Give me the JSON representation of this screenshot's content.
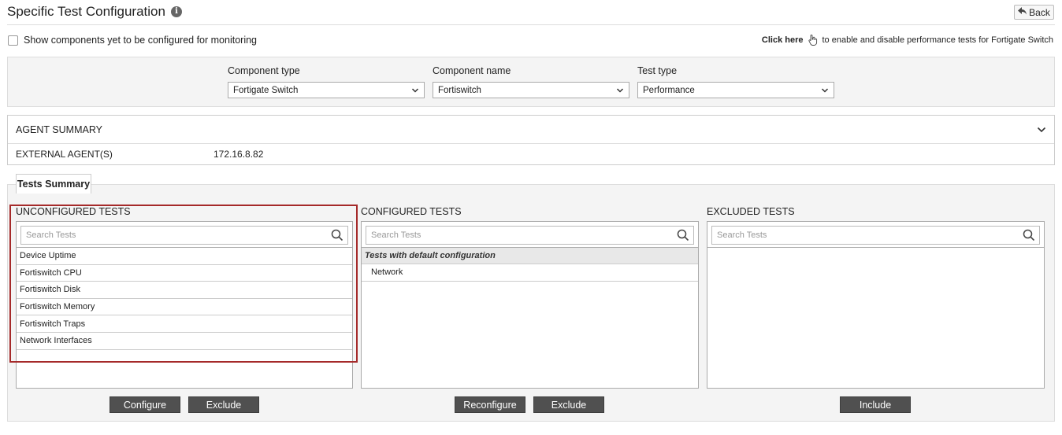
{
  "header": {
    "title": "Specific Test Configuration",
    "info_glyph": "i",
    "back_label": "Back"
  },
  "show_components": {
    "label": "Show components yet to be configured for monitoring",
    "checked": false
  },
  "click_here": {
    "link_label": "Click here",
    "text": "to enable and disable performance tests for Fortigate Switch"
  },
  "filters": {
    "component_type": {
      "label": "Component type",
      "value": "Fortigate Switch"
    },
    "component_name": {
      "label": "Component name",
      "value": "Fortiswitch"
    },
    "test_type": {
      "label": "Test type",
      "value": "Performance"
    }
  },
  "agent_summary": {
    "title": "AGENT SUMMARY",
    "external_label": "EXTERNAL AGENT(S)",
    "external_value": "172.16.8.82"
  },
  "tests_summary": {
    "tab_label": "Tests Summary",
    "unconfigured": {
      "title": "UNCONFIGURED TESTS",
      "search_placeholder": "Search Tests",
      "items": [
        "Device Uptime",
        "Fortiswitch CPU",
        "Fortiswitch Disk",
        "Fortiswitch Memory",
        "Fortiswitch Traps",
        "Network Interfaces"
      ],
      "buttons": [
        "Configure",
        "Exclude"
      ]
    },
    "configured": {
      "title": "CONFIGURED TESTS",
      "search_placeholder": "Search Tests",
      "group_label": "Tests with default configuration",
      "items": [
        "Network"
      ],
      "buttons": [
        "Reconfigure",
        "Exclude"
      ]
    },
    "excluded": {
      "title": "EXCLUDED TESTS",
      "search_placeholder": "Search Tests",
      "items": [],
      "buttons": [
        "Include"
      ]
    }
  },
  "colors": {
    "button_bg": "#505050",
    "highlight": "#a52a2a",
    "panel_bg": "#f4f4f4"
  }
}
